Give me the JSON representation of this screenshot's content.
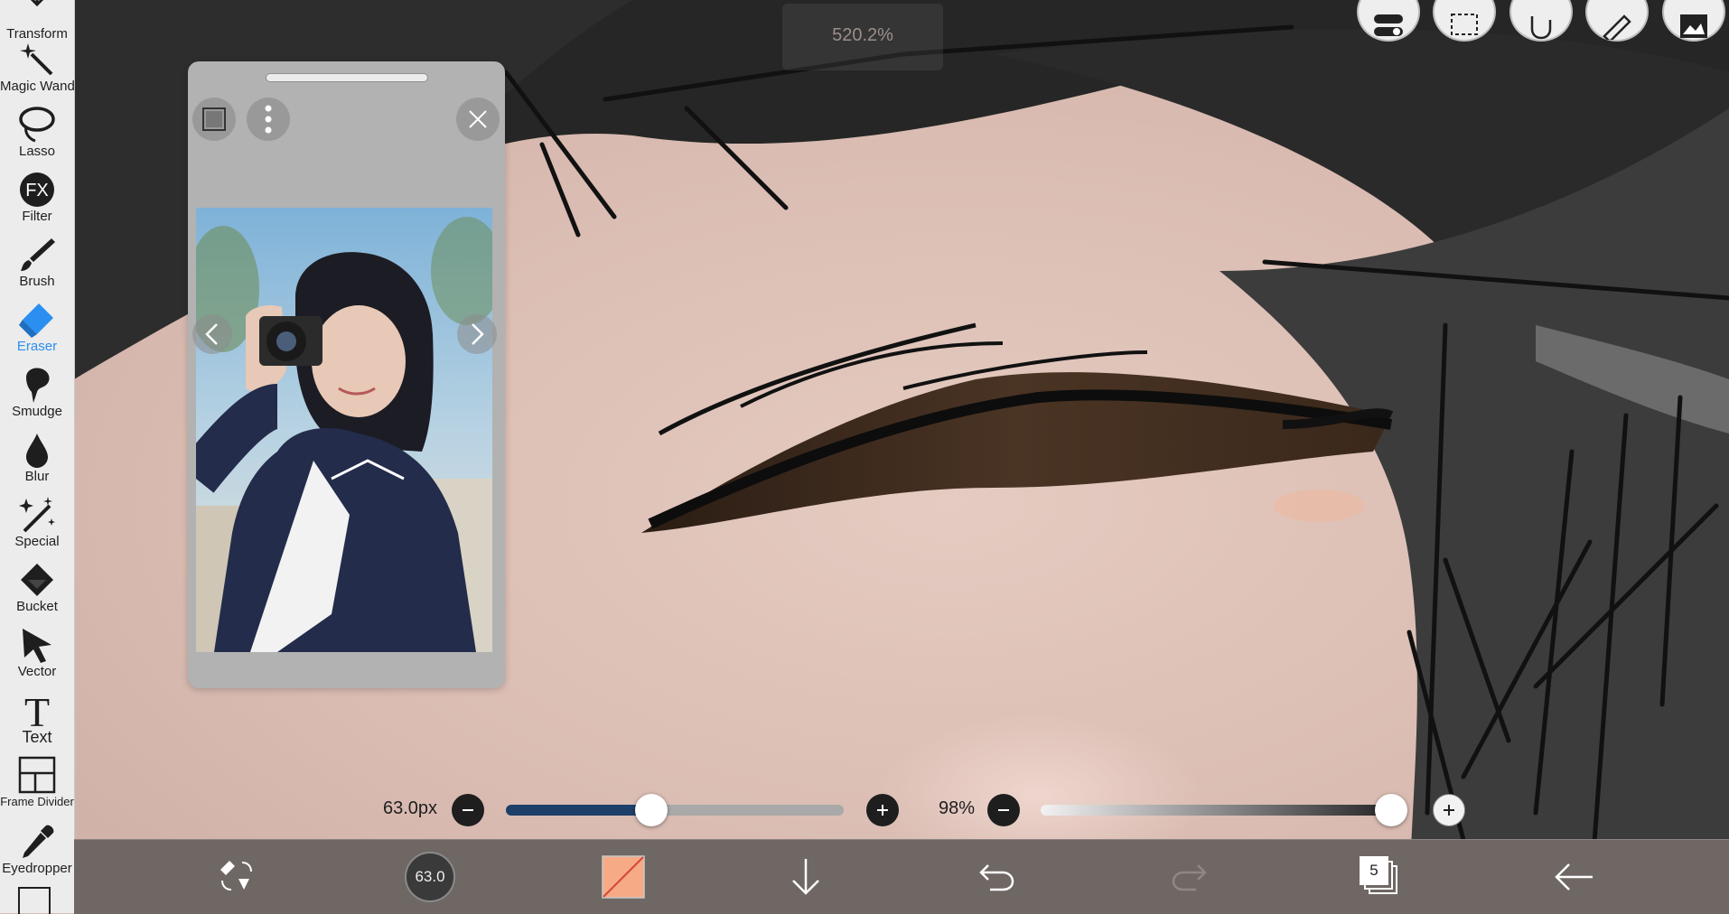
{
  "zoom": {
    "value": "520.2%"
  },
  "toolbar": {
    "tools": [
      {
        "label": "Transform",
        "icon": "transform-icon"
      },
      {
        "label": "Magic Wand",
        "icon": "magic-wand-icon"
      },
      {
        "label": "Lasso",
        "icon": "lasso-icon"
      },
      {
        "label": "Filter",
        "icon": "filter-fx-icon",
        "badge": "FX"
      },
      {
        "label": "Brush",
        "icon": "brush-icon"
      },
      {
        "label": "Eraser",
        "icon": "eraser-icon",
        "active": true
      },
      {
        "label": "Smudge",
        "icon": "smudge-icon"
      },
      {
        "label": "Blur",
        "icon": "blur-icon"
      },
      {
        "label": "Special",
        "icon": "special-icon"
      },
      {
        "label": "Bucket",
        "icon": "bucket-icon"
      },
      {
        "label": "Vector",
        "icon": "vector-icon"
      },
      {
        "label": "Text",
        "icon": "text-icon",
        "badge": "T"
      },
      {
        "label": "Frame Divider",
        "icon": "frame-divider-icon"
      },
      {
        "label": "Eyedropper",
        "icon": "eyedropper-icon"
      }
    ],
    "accent_color": "#2a8ff0"
  },
  "top_buttons": [
    "toggle-switch-icon",
    "selection-icon",
    "hand-icon",
    "ruler-icon",
    "layer-image-icon"
  ],
  "reference_window": {
    "icons": [
      "frame-icon",
      "more-vertical-icon",
      "close-icon",
      "prev-arrow-icon",
      "next-arrow-icon"
    ]
  },
  "brush_size": {
    "label": "63.0px",
    "level": 0.43
  },
  "opacity": {
    "label": "98%",
    "level": 0.98
  },
  "bottom_bar": {
    "brush_size_badge": "63.0",
    "layer_count": "5",
    "primary_color": "#f6ab86",
    "icons": [
      "swap-tool-icon",
      "brush-size-icon",
      "color-icon",
      "download-arrow-icon",
      "undo-icon",
      "redo-icon",
      "layers-icon",
      "back-arrow-icon"
    ]
  }
}
